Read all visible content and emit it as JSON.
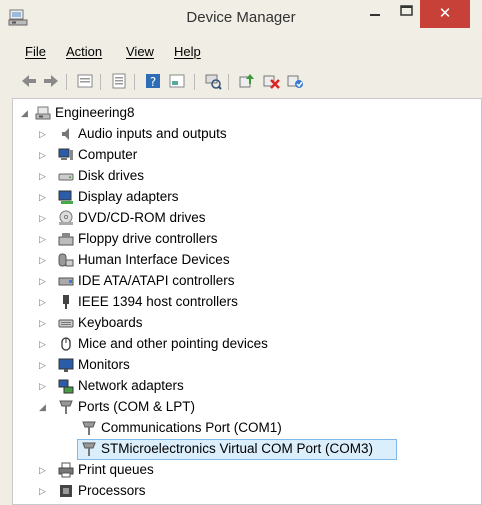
{
  "window": {
    "title": "Device Manager",
    "minimize_label": "–",
    "maximize_label": "□",
    "close_label": "✕"
  },
  "menu": {
    "items": [
      {
        "label": "File"
      },
      {
        "label": "Action"
      },
      {
        "label": "View"
      },
      {
        "label": "Help"
      }
    ]
  },
  "toolbar": {
    "buttons": [
      "back-arrow-icon",
      "forward-arrow-icon",
      "properties-icon",
      "properties-list-icon",
      "help-icon",
      "show-hidden-icon",
      "scan-hardware-icon",
      "update-driver-icon",
      "uninstall-icon",
      "enable-device-icon"
    ]
  },
  "tree": {
    "root": {
      "label": "Engineering8",
      "expanded": true
    },
    "categories": [
      {
        "label": "Audio inputs and outputs",
        "icon": "speaker-icon"
      },
      {
        "label": "Computer",
        "icon": "computer-icon"
      },
      {
        "label": "Disk drives",
        "icon": "disk-drive-icon"
      },
      {
        "label": "Display adapters",
        "icon": "display-adapter-icon"
      },
      {
        "label": "DVD/CD-ROM drives",
        "icon": "dvd-drive-icon"
      },
      {
        "label": "Floppy drive controllers",
        "icon": "floppy-controller-icon"
      },
      {
        "label": "Human Interface Devices",
        "icon": "hid-icon"
      },
      {
        "label": "IDE ATA/ATAPI controllers",
        "icon": "ide-controller-icon"
      },
      {
        "label": "IEEE 1394 host controllers",
        "icon": "ieee1394-icon"
      },
      {
        "label": "Keyboards",
        "icon": "keyboard-icon"
      },
      {
        "label": "Mice and other pointing devices",
        "icon": "mouse-icon"
      },
      {
        "label": "Monitors",
        "icon": "monitor-icon"
      },
      {
        "label": "Network adapters",
        "icon": "network-adapter-icon"
      },
      {
        "label": "Ports (COM & LPT)",
        "icon": "port-icon",
        "expanded": true
      },
      {
        "label": "Print queues",
        "icon": "printer-icon"
      },
      {
        "label": "Processors",
        "icon": "processor-icon"
      }
    ],
    "ports_children": [
      {
        "label": "Communications Port (COM1)",
        "icon": "port-icon"
      },
      {
        "label": "STMicroelectronics Virtual COM Port (COM3)",
        "icon": "port-icon",
        "selected": true
      }
    ]
  }
}
